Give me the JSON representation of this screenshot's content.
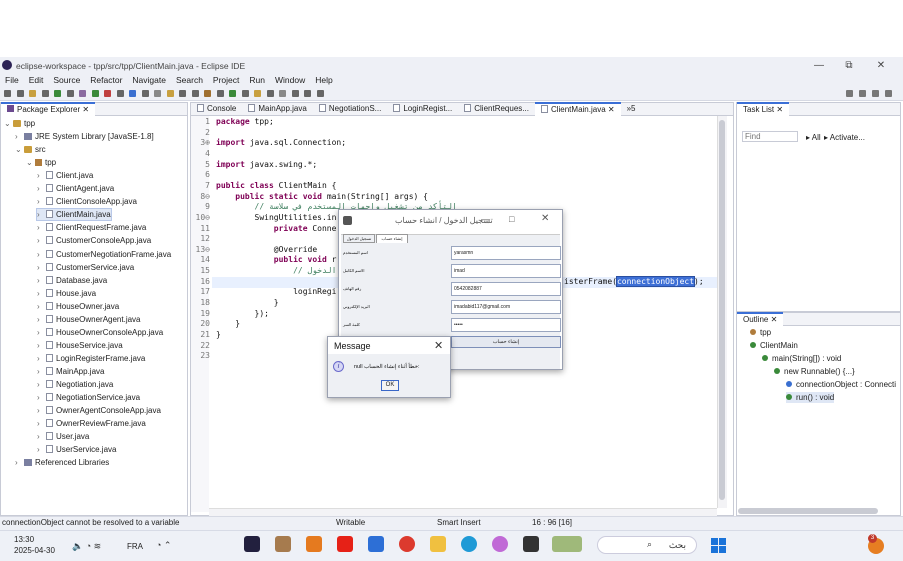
{
  "window": {
    "title": "eclipse-workspace - tpp/src/tpp/ClientMain.java - Eclipse IDE",
    "min": "—",
    "max": "⧉",
    "close": "✕"
  },
  "menu": [
    "File",
    "Edit",
    "Source",
    "Refactor",
    "Navigate",
    "Search",
    "Project",
    "Run",
    "Window",
    "Help"
  ],
  "package_explorer": {
    "tab": "Package Explorer",
    "tree": [
      {
        "label": "tpp",
        "kind": "project",
        "indent": 0,
        "arrow": "⌄"
      },
      {
        "label": "JRE System Library [JavaSE-1.8]",
        "kind": "lib",
        "indent": 1,
        "arrow": "›"
      },
      {
        "label": "src",
        "kind": "folder",
        "indent": 1,
        "arrow": "⌄"
      },
      {
        "label": "tpp",
        "kind": "pkg",
        "indent": 2,
        "arrow": "⌄"
      },
      {
        "label": "Client.java",
        "kind": "java",
        "indent": 3,
        "arrow": "›"
      },
      {
        "label": "ClientAgent.java",
        "kind": "java",
        "indent": 3,
        "arrow": "›"
      },
      {
        "label": "ClientConsoleApp.java",
        "kind": "java",
        "indent": 3,
        "arrow": "›"
      },
      {
        "label": "ClientMain.java",
        "kind": "java",
        "indent": 3,
        "arrow": "›",
        "selected": true
      },
      {
        "label": "ClientRequestFrame.java",
        "kind": "java",
        "indent": 3,
        "arrow": "›"
      },
      {
        "label": "CustomerConsoleApp.java",
        "kind": "java",
        "indent": 3,
        "arrow": "›"
      },
      {
        "label": "CustomerNegotiationFrame.java",
        "kind": "java",
        "indent": 3,
        "arrow": "›"
      },
      {
        "label": "CustomerService.java",
        "kind": "java",
        "indent": 3,
        "arrow": "›"
      },
      {
        "label": "Database.java",
        "kind": "java",
        "indent": 3,
        "arrow": "›"
      },
      {
        "label": "House.java",
        "kind": "java",
        "indent": 3,
        "arrow": "›"
      },
      {
        "label": "HouseOwner.java",
        "kind": "java",
        "indent": 3,
        "arrow": "›"
      },
      {
        "label": "HouseOwnerAgent.java",
        "kind": "java",
        "indent": 3,
        "arrow": "›"
      },
      {
        "label": "HouseOwnerConsoleApp.java",
        "kind": "java",
        "indent": 3,
        "arrow": "›"
      },
      {
        "label": "HouseService.java",
        "kind": "java",
        "indent": 3,
        "arrow": "›"
      },
      {
        "label": "LoginRegisterFrame.java",
        "kind": "java",
        "indent": 3,
        "arrow": "›"
      },
      {
        "label": "MainApp.java",
        "kind": "java",
        "indent": 3,
        "arrow": "›"
      },
      {
        "label": "Negotiation.java",
        "kind": "java",
        "indent": 3,
        "arrow": "›"
      },
      {
        "label": "NegotiationService.java",
        "kind": "java",
        "indent": 3,
        "arrow": "›"
      },
      {
        "label": "OwnerAgentConsoleApp.java",
        "kind": "java",
        "indent": 3,
        "arrow": "›"
      },
      {
        "label": "OwnerReviewFrame.java",
        "kind": "java",
        "indent": 3,
        "arrow": "›"
      },
      {
        "label": "User.java",
        "kind": "java",
        "indent": 3,
        "arrow": "›"
      },
      {
        "label": "UserService.java",
        "kind": "java",
        "indent": 3,
        "arrow": "›"
      },
      {
        "label": "Referenced Libraries",
        "kind": "lib",
        "indent": 1,
        "arrow": "›"
      }
    ]
  },
  "editor_tabs": [
    "Console",
    "MainApp.java",
    "NegotiationS...",
    "LoginRegist...",
    "ClientReques...",
    "ClientMain.java"
  ],
  "editor_overflow": "»5",
  "code": [
    {
      "n": "1",
      "t": "package tpp;"
    },
    {
      "n": "2",
      "t": ""
    },
    {
      "n": "3⊕",
      "t": "import java.sql.Connection;"
    },
    {
      "n": "4",
      "t": ""
    },
    {
      "n": "5",
      "t": "import javax.swing.*;"
    },
    {
      "n": "6",
      "t": ""
    },
    {
      "n": "7",
      "t": "public class ClientMain {"
    },
    {
      "n": "8⊖",
      "t": "    public static void main(String[] args) {"
    },
    {
      "n": "9",
      "t": "        // التأكد من تشغيل واجهات المستخدم في سلاسة"
    },
    {
      "n": "10⊖",
      "t": "        SwingUtilities.in"
    },
    {
      "n": "11",
      "t": "            private Conne"
    },
    {
      "n": "12",
      "t": ""
    },
    {
      "n": "13⊖",
      "t": "            @Override"
    },
    {
      "n": "14",
      "t": "            public void r"
    },
    {
      "n": "15",
      "t": "                // فتح نافذة تسجيل الدخول"
    },
    {
      "n": "16",
      "t": "                LoginRegi"
    },
    {
      "n": "17",
      "t": "                loginRegi"
    },
    {
      "n": "18",
      "t": "            }"
    },
    {
      "n": "19",
      "t": "        });"
    },
    {
      "n": "20",
      "t": "    }"
    },
    {
      "n": "21",
      "t": "}"
    },
    {
      "n": "22",
      "t": ""
    },
    {
      "n": "23",
      "t": ""
    }
  ],
  "code_tail": {
    "text": "isterFrame(",
    "highlight": "connectionObject",
    "end": ");"
  },
  "task_list": {
    "tab": "Task List",
    "find_placeholder": "Find",
    "all": "All",
    "activate": "Activate..."
  },
  "outline": {
    "tab": "Outline",
    "items": [
      {
        "label": "tpp",
        "indent": 0
      },
      {
        "label": "ClientMain",
        "indent": 0
      },
      {
        "label": "main(String[]) : void",
        "indent": 1
      },
      {
        "label": "new Runnable() {...}",
        "indent": 2
      },
      {
        "label": "connectionObject : Connecti",
        "indent": 3
      },
      {
        "label": "run() : void",
        "indent": 3,
        "selected": true
      }
    ]
  },
  "login_dialog": {
    "title": "تسجيل الدخول / انشاء حساب",
    "tabs": [
      "تسجيل الدخول",
      "إنشاء حساب"
    ],
    "labels": [
      "اسم المستخدم",
      "الاسم الكامل",
      "رقم الهاتف",
      "البريد الإلكتروني",
      "كلمة السر"
    ],
    "values": [
      "yarasmn",
      "imad",
      "0542082887",
      "imadabid117@gmail.com",
      "•••••"
    ],
    "button": "إنشاء حساب"
  },
  "message_dialog": {
    "title": "Message",
    "text": "null خطأ أثناء إنشاء الحساب:",
    "ok": "OK",
    "info": "i"
  },
  "status": {
    "error": "connectionObject cannot be resolved to a variable",
    "mode": "Writable",
    "insert": "Smart Insert",
    "pos": "16 : 96 [16]"
  },
  "taskbar": {
    "time": "13:30",
    "date": "2025-04-30",
    "lang": "FRA",
    "search": "بحث",
    "badge": "3"
  }
}
